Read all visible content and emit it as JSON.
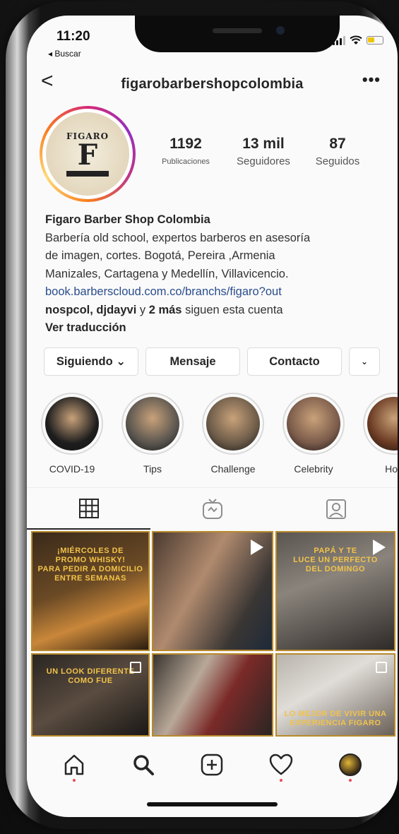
{
  "status_bar": {
    "time": "11:20",
    "back_app": "◂ Buscar"
  },
  "nav": {
    "username": "figarobarbershopcolombia",
    "back_glyph": "<",
    "more_glyph": "•••"
  },
  "avatar": {
    "logo_text": "FIGARO",
    "logo_mark": "F"
  },
  "stats": [
    {
      "value": "1192",
      "label": "Publicaciones"
    },
    {
      "value": "13 mil",
      "label": "Seguidores"
    },
    {
      "value": "87",
      "label": "Seguidos"
    }
  ],
  "bio": {
    "name": "Figaro Barber Shop Colombia",
    "line1": "Barbería old school, expertos barberos en asesoría",
    "line2": "de imagen, cortes. Bogotá, Pereira ,Armenia",
    "line3": "Manizales, Cartagena y Medellín, Villavicencio.",
    "link": "book.barberscloud.com.co/branchs/figaro?out",
    "followed_by_names": "nospcol, djdayvi",
    "followed_by_mid": " y ",
    "followed_by_more": "2 más",
    "followed_by_suffix": " siguen esta cuenta",
    "translate": "Ver traducción"
  },
  "actions": {
    "following": "Siguiendo ⌄",
    "message": "Mensaje",
    "contact": "Contacto",
    "more": "⌄"
  },
  "highlights": [
    {
      "label": "COVID-19",
      "color": "#1e1e1e"
    },
    {
      "label": "Tips",
      "color": "#5a554f"
    },
    {
      "label": "Challenge",
      "color": "#6b5a48"
    },
    {
      "label": "Celebrity",
      "color": "#7a5a4a"
    },
    {
      "label": "Hon",
      "color": "#6a3a22"
    }
  ],
  "posts": [
    {
      "caption": "¡MIÉRCOLES DE\nPROMO WHISKY!\nPARA PEDIR A DOMICILIO ENTRE SEMANAS",
      "type": "image"
    },
    {
      "caption": "",
      "type": "video"
    },
    {
      "caption": "PAPÁ Y TE\nLUCE UN PERFECTO\nDEL DOMINGO",
      "type": "video"
    },
    {
      "caption": "UN LOOK DIFERENTE\nCOMO FUE",
      "type": "carousel"
    },
    {
      "caption": "",
      "type": "image"
    },
    {
      "caption": "LO MEJOR DE VIVIR UNA\nEXPERIENCIA FIGARO",
      "type": "carousel"
    }
  ],
  "icons": {
    "tab_grid": "grid-icon",
    "tab_igtv": "igtv-icon",
    "tab_tagged": "tagged-icon",
    "nav_home": "home-icon",
    "nav_search": "search-icon",
    "nav_add": "add-post-icon",
    "nav_activity": "heart-icon",
    "nav_profile": "profile-avatar"
  },
  "colors": {
    "link": "#2b4e8c",
    "notification_dot": "#ed4956",
    "accent_gold": "#b88a2c"
  }
}
